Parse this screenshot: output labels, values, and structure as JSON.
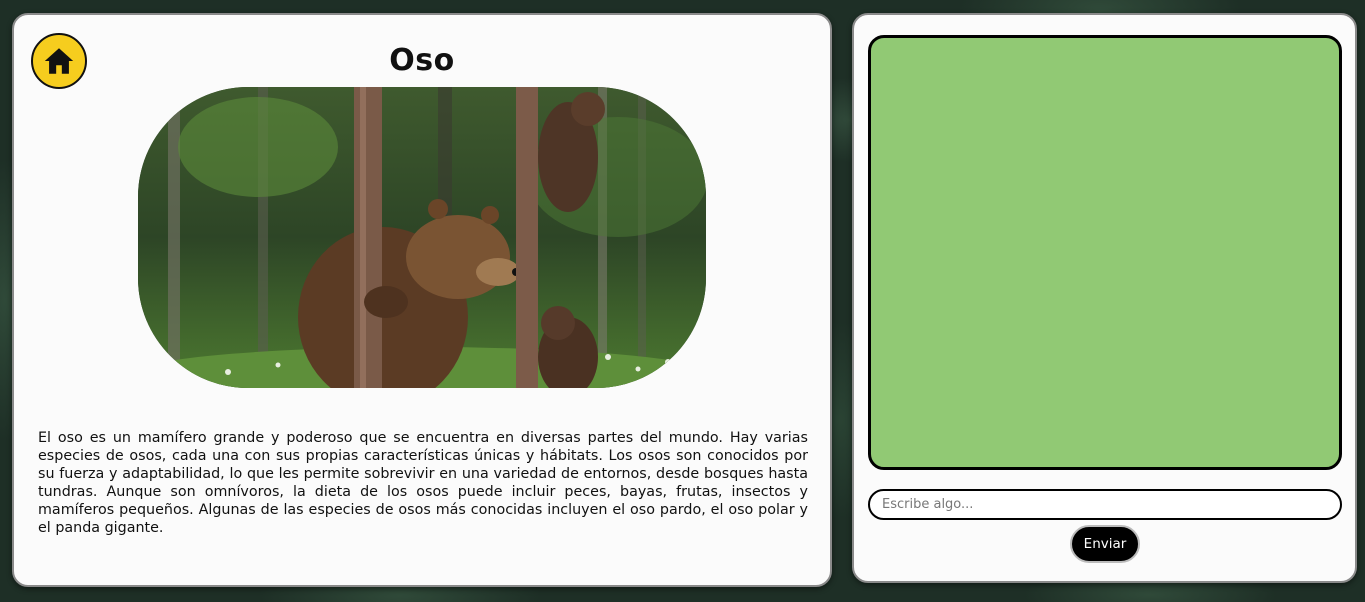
{
  "info_card": {
    "home_icon": "home-icon",
    "title": "Oso",
    "image_alt": "bear-photo",
    "description": "El oso es un mamífero grande y poderoso que se encuentra en diversas partes del mundo. Hay varias especies de osos, cada una con sus propias características únicas y hábitats. Los osos son conocidos por su fuerza y adaptabilidad, lo que les permite sobrevivir en una variedad de entornos, desde bosques hasta tundras. Aunque son omnívoros, la dieta de los osos puede incluir peces, bayas, frutas, insectos y mamíferos pequeños. Algunas de las especies de osos más conocidas incluyen el oso pardo, el oso polar y el panda gigante."
  },
  "chat": {
    "input_value": "",
    "input_placeholder": "Escribe algo...",
    "send_label": "Enviar"
  },
  "colors": {
    "home_button": "#f6cd1e",
    "chat_area": "#91c974",
    "send_button": "#000000"
  }
}
